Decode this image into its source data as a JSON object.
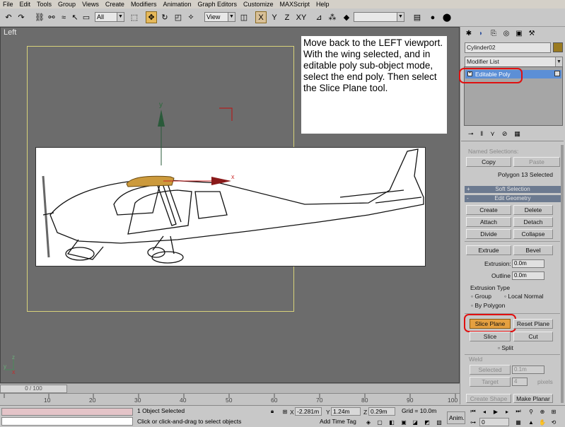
{
  "menu": [
    "File",
    "Edit",
    "Tools",
    "Group",
    "Views",
    "Create",
    "Modifiers",
    "Animation",
    "Graph Editors",
    "Customize",
    "MAXScript",
    "Help"
  ],
  "toolbar": {
    "selection_filter": "All",
    "ref_coord": "View",
    "named_selection": ""
  },
  "viewport": {
    "label": "Left",
    "instruction": "Move back to the LEFT viewport.  With the wing selected, and in editable poly sub-object mode, select the end poly.  Then select the Slice Plane tool.",
    "gizmo_y": "y",
    "gizmo_x": "x",
    "axis_y": "y",
    "axis_z": "z"
  },
  "panel": {
    "object_name": "Cylinder02",
    "object_color": "#9a7a20",
    "modifier_list": "Modifier List",
    "stack_item": "Editable Poly",
    "named_selections": "Named Selections:",
    "copy": "Copy",
    "paste": "Paste",
    "polygon_status": "Polygon 13 Selected",
    "soft_selection": "Soft Selection",
    "edit_geometry": "Edit Geometry",
    "create": "Create",
    "delete": "Delete",
    "attach": "Attach",
    "detach": "Detach",
    "divide": "Divide",
    "collapse": "Collapse",
    "extrude": "Extrude",
    "bevel": "Bevel",
    "extrusion_label": "Extrusion:",
    "extrusion_value": "0.0m",
    "outline_label": "Outline",
    "outline_value": "0.0m",
    "extrusion_type": "Extrusion Type",
    "group": "Group",
    "local_normal": "Local Normal",
    "by_polygon": "By Polygon",
    "slice_plane": "Slice Plane",
    "reset_plane": "Reset Plane",
    "slice": "Slice",
    "cut": "Cut",
    "split": "Split",
    "weld": "Weld",
    "selected": "Selected",
    "weld_value": "0.1m",
    "target": "Target",
    "target_value": "4",
    "pixels": "pixels",
    "create_shape": "Create Shape",
    "make_planar": "Make Planar",
    "plus": "+",
    "minus": "-"
  },
  "timeline": {
    "slider": "0 / 100",
    "ticks": [
      "10",
      "20",
      "30",
      "40",
      "50",
      "60",
      "70",
      "80",
      "90",
      "100"
    ]
  },
  "status": {
    "selection": "1 Object Selected",
    "prompt": "Click or click-and-drag to select objects",
    "x_label": "X",
    "x_value": "-2.281m",
    "y_label": "Y",
    "y_value": "1.24m",
    "z_label": "Z",
    "z_value": "0.29m",
    "grid": "Grid = 10.0m",
    "add_time_tag": "Add Time Tag",
    "anim": "Anim.",
    "frame": "0"
  }
}
